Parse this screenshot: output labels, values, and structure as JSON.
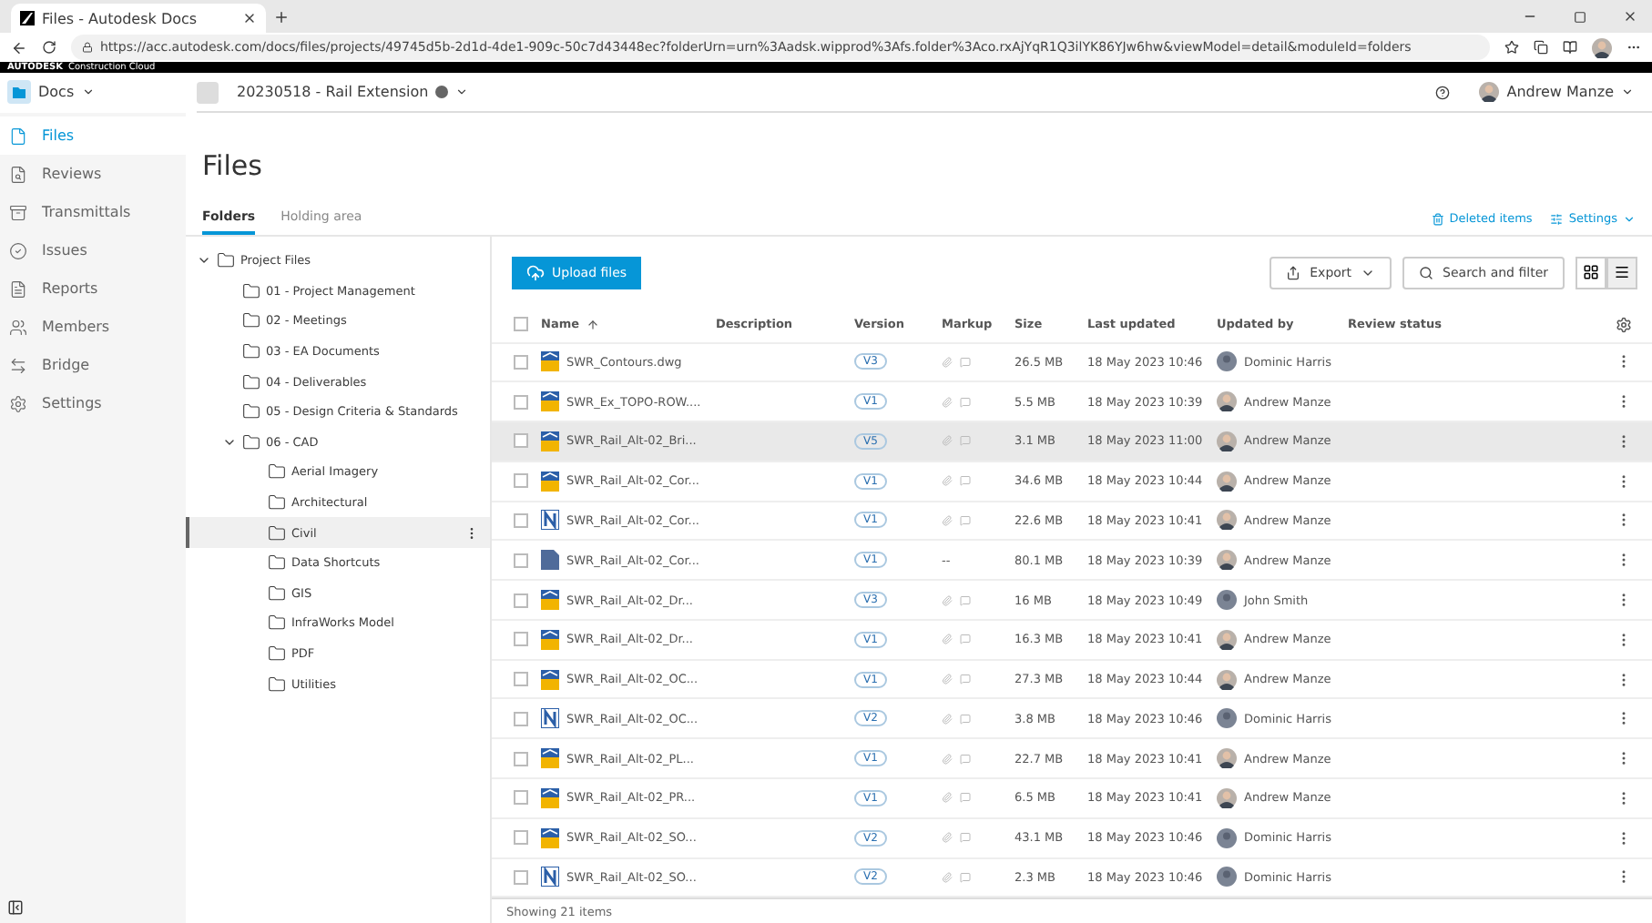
{
  "browser": {
    "tab_title": "Files - Autodesk Docs",
    "url": "https://acc.autodesk.com/docs/files/projects/49745d5b-2d1d-4de1-909c-50c7d43448ec?folderUrn=urn%3Aadsk.wipprod%3Afs.folder%3Aco.rxAjYqR1Q3ilYK86YJw6hw&viewModel=detail&moduleId=folders"
  },
  "brand": {
    "name": "AUTODESK",
    "product": "Construction Cloud"
  },
  "header": {
    "module": "Docs",
    "project": "20230518 - Rail Extension",
    "user": "Andrew Manze"
  },
  "sidebar": {
    "items": [
      {
        "label": "Files",
        "selected": true
      },
      {
        "label": "Reviews",
        "selected": false
      },
      {
        "label": "Transmittals",
        "selected": false
      },
      {
        "label": "Issues",
        "selected": false
      },
      {
        "label": "Reports",
        "selected": false
      },
      {
        "label": "Members",
        "selected": false
      },
      {
        "label": "Bridge",
        "selected": false
      },
      {
        "label": "Settings",
        "selected": false
      }
    ]
  },
  "page": {
    "title": "Files",
    "deleted_items": "Deleted items",
    "settings": "Settings"
  },
  "tabs": [
    {
      "label": "Folders",
      "selected": true
    },
    {
      "label": "Holding area",
      "selected": false
    }
  ],
  "tree": [
    {
      "label": "Project Files",
      "expanded": true,
      "selected": false,
      "children": [
        {
          "label": "01 - Project Management",
          "selected": false
        },
        {
          "label": "02 - Meetings",
          "selected": false
        },
        {
          "label": "03 - EA Documents",
          "selected": false
        },
        {
          "label": "04 - Deliverables",
          "selected": false
        },
        {
          "label": "05 - Design Criteria & Standards",
          "selected": false
        },
        {
          "label": "06 - CAD",
          "expanded": true,
          "selected": false,
          "children": [
            {
              "label": "Aerial Imagery",
              "selected": false
            },
            {
              "label": "Architectural",
              "selected": false
            },
            {
              "label": "Civil",
              "selected": true
            },
            {
              "label": "Data Shortcuts",
              "selected": false
            },
            {
              "label": "GIS",
              "selected": false
            },
            {
              "label": "InfraWorks Model",
              "selected": false
            },
            {
              "label": "PDF",
              "selected": false
            },
            {
              "label": "Utilities",
              "selected": false
            }
          ]
        }
      ]
    }
  ],
  "toolbar": {
    "upload": "Upload files",
    "export": "Export",
    "search": "Search and filter"
  },
  "table": {
    "all_checked": false,
    "columns": [
      "Name",
      "Description",
      "Version",
      "Markup",
      "Size",
      "Last updated",
      "Updated by",
      "Review status"
    ],
    "rows": [
      {
        "kind": "dwg",
        "checked": false,
        "name": "SWR_Contours.dwg",
        "version": "V3",
        "size": "26.5 MB",
        "updated": "18 May 2023 10:46",
        "by": "Dominic Harris",
        "photo": false,
        "hovered": false
      },
      {
        "kind": "dwg",
        "checked": false,
        "name": "SWR_Ex_TOPO-ROW....",
        "version": "V1",
        "size": "5.5 MB",
        "updated": "18 May 2023 10:39",
        "by": "Andrew Manze",
        "photo": true,
        "hovered": false
      },
      {
        "kind": "dwg",
        "checked": false,
        "name": "SWR_Rail_Alt-02_Bri...",
        "version": "V5",
        "size": "3.1 MB",
        "updated": "18 May 2023 11:00",
        "by": "Andrew Manze",
        "photo": true,
        "hovered": true
      },
      {
        "kind": "dwg",
        "checked": false,
        "name": "SWR_Rail_Alt-02_Cor...",
        "version": "V1",
        "size": "34.6 MB",
        "updated": "18 May 2023 10:44",
        "by": "Andrew Manze",
        "photo": true,
        "hovered": false
      },
      {
        "kind": "nwd",
        "checked": false,
        "name": "SWR_Rail_Alt-02_Cor...",
        "version": "V1",
        "size": "22.6 MB",
        "updated": "18 May 2023 10:41",
        "by": "Andrew Manze",
        "photo": true,
        "hovered": false
      },
      {
        "kind": "doc",
        "checked": false,
        "name": "SWR_Rail_Alt-02_Cor...",
        "version": "V1",
        "markup": "--",
        "size": "80.1 MB",
        "updated": "18 May 2023 10:39",
        "by": "Andrew Manze",
        "photo": true,
        "hovered": false
      },
      {
        "kind": "dwg",
        "checked": false,
        "name": "SWR_Rail_Alt-02_Dr...",
        "version": "V3",
        "size": "16 MB",
        "updated": "18 May 2023 10:49",
        "by": "John Smith",
        "photo": false,
        "hovered": false
      },
      {
        "kind": "dwg",
        "checked": false,
        "name": "SWR_Rail_Alt-02_Dr...",
        "version": "V1",
        "size": "16.3 MB",
        "updated": "18 May 2023 10:41",
        "by": "Andrew Manze",
        "photo": true,
        "hovered": false
      },
      {
        "kind": "dwg",
        "checked": false,
        "name": "SWR_Rail_Alt-02_OC...",
        "version": "V1",
        "size": "27.3 MB",
        "updated": "18 May 2023 10:44",
        "by": "Andrew Manze",
        "photo": true,
        "hovered": false
      },
      {
        "kind": "nwd",
        "checked": false,
        "name": "SWR_Rail_Alt-02_OC...",
        "version": "V2",
        "size": "3.8 MB",
        "updated": "18 May 2023 10:46",
        "by": "Dominic Harris",
        "photo": false,
        "hovered": false
      },
      {
        "kind": "dwg",
        "checked": false,
        "name": "SWR_Rail_Alt-02_PL...",
        "version": "V1",
        "size": "22.7 MB",
        "updated": "18 May 2023 10:41",
        "by": "Andrew Manze",
        "photo": true,
        "hovered": false
      },
      {
        "kind": "dwg",
        "checked": false,
        "name": "SWR_Rail_Alt-02_PR...",
        "version": "V1",
        "size": "6.5 MB",
        "updated": "18 May 2023 10:41",
        "by": "Andrew Manze",
        "photo": true,
        "hovered": false
      },
      {
        "kind": "dwg",
        "checked": false,
        "name": "SWR_Rail_Alt-02_SO...",
        "version": "V2",
        "size": "43.1 MB",
        "updated": "18 May 2023 10:46",
        "by": "Dominic Harris",
        "photo": false,
        "hovered": false
      },
      {
        "kind": "nwd",
        "checked": false,
        "name": "SWR_Rail_Alt-02_SO...",
        "version": "V2",
        "size": "2.3 MB",
        "updated": "18 May 2023 10:46",
        "by": "Dominic Harris",
        "photo": false,
        "hovered": false
      }
    ]
  },
  "status_bar": "Showing 21 items"
}
